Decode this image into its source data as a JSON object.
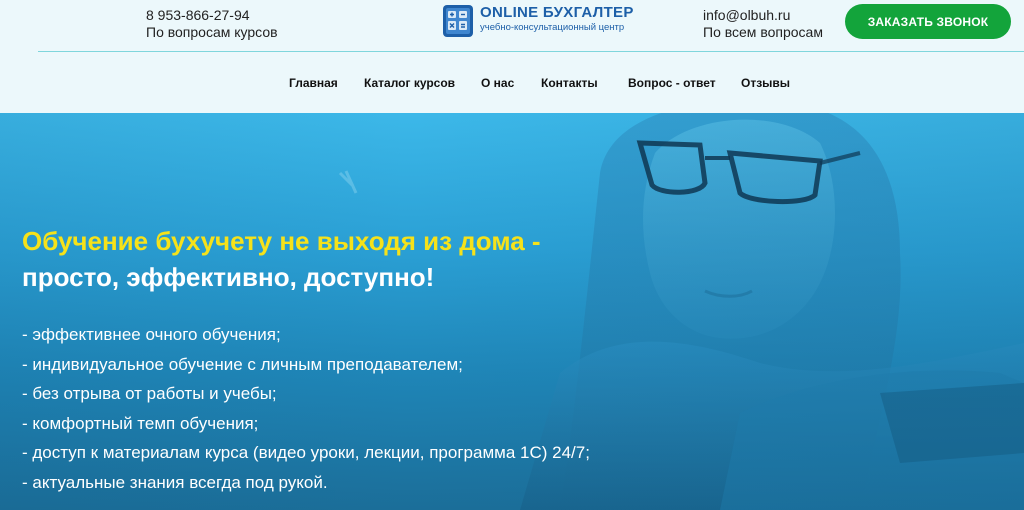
{
  "header": {
    "phone": "8 953-866-27-94",
    "phone_caption": "По вопросам курсов",
    "email": "info@olbuh.ru",
    "email_caption": "По всем вопросам",
    "logo_title": "ONLINE БУХГАЛТЕР",
    "logo_subtitle": "учебно-консультационный центр",
    "call_button": "ЗАКАЗАТЬ ЗВОНОК"
  },
  "nav": {
    "items": [
      {
        "label": "Главная"
      },
      {
        "label": "Каталог курсов"
      },
      {
        "label": "О нас"
      },
      {
        "label": "Контакты"
      },
      {
        "label": "Вопрос - ответ"
      },
      {
        "label": "Отзывы"
      }
    ]
  },
  "hero": {
    "title_line1": "Обучение бухучету не выходя из дома -",
    "title_line2": "просто, эффективно, доступно!",
    "benefits": [
      "- эффективнее очного обучения;",
      "- индивидуальное обучение с личным преподавателем;",
      "- без отрыва от работы и учебы;",
      "- комфортный темп обучения;",
      "- доступ к материалам курса (видео уроки, лекции, программа 1С) 24/7;",
      "- актуальные знания всегда под рукой."
    ]
  },
  "colors": {
    "accent_green": "#13a43b",
    "title_yellow": "#f6e21a",
    "logo_blue": "#1d5fa8",
    "header_bg": "#ecf8fb"
  }
}
